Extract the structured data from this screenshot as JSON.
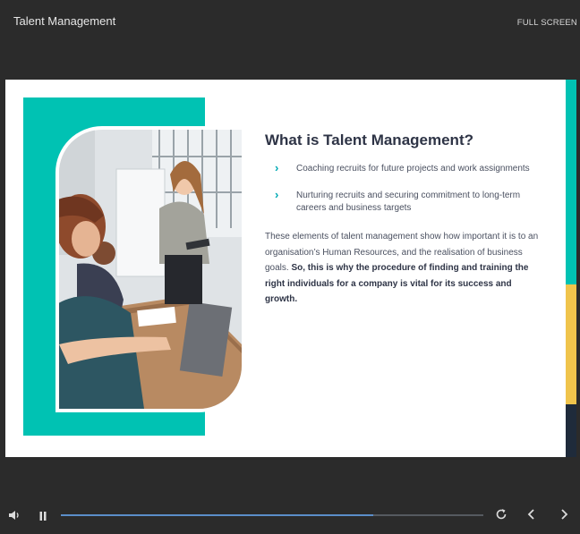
{
  "app": {
    "title": "Talent Management",
    "fullscreen_label": "FULL SCREEN"
  },
  "slide": {
    "heading": "What is Talent Management?",
    "bullets": [
      {
        "chevron": "›",
        "text": "Coaching recruits for future projects and work assignments"
      },
      {
        "chevron": "›",
        "text": "Nurturing recruits and securing commitment to long-term careers and business targets"
      }
    ],
    "paragraph": {
      "normal": "These elements of talent management show how important it is to an organisation’s Human Resources, and the realisation of business goals. ",
      "bold": "So, this is why the procedure of finding and training the right individuals for a company is vital for its success and growth."
    },
    "colors": {
      "teal": "#00c2b3",
      "yellow": "#f0c44c",
      "navy": "#1f2b3b"
    }
  },
  "player": {
    "progress": 0.74,
    "icons": [
      "volume-icon",
      "pause-icon",
      "replay-icon",
      "chevron-left-icon",
      "chevron-right-icon"
    ]
  }
}
